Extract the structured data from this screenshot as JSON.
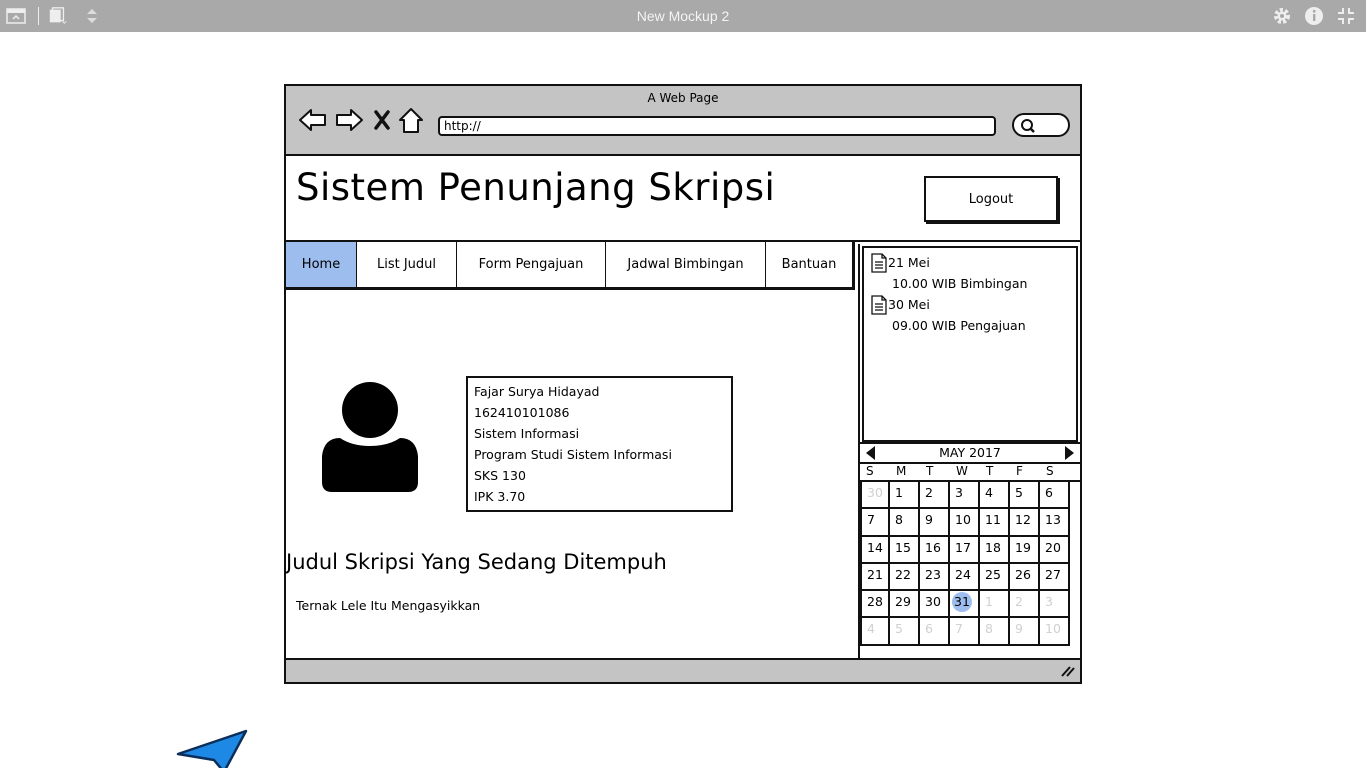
{
  "app": {
    "title": "New Mockup 2"
  },
  "browser": {
    "page_title": "A Web Page",
    "url": "http://"
  },
  "site": {
    "title": "Sistem Penunjang Skripsi",
    "logout_label": "Logout"
  },
  "tabs": [
    {
      "label": "Home",
      "active": true
    },
    {
      "label": "List Judul",
      "active": false
    },
    {
      "label": "Form Pengajuan",
      "active": false
    },
    {
      "label": "Jadwal Bimbingan",
      "active": false
    },
    {
      "label": "Bantuan",
      "active": false
    }
  ],
  "profile": {
    "name": "Fajar Surya Hidayad",
    "nim": "162410101086",
    "faculty": "Sistem Informasi",
    "program": "Program Studi Sistem Informasi",
    "sks": "SKS 130",
    "ipk": "IPK 3.70"
  },
  "thesis": {
    "heading": "Judul Skripsi Yang Sedang Ditempuh",
    "title": "Ternak Lele Itu Mengasyikkan"
  },
  "events": [
    {
      "date": "21 Mei",
      "detail": "10.00 WIB Bimbingan"
    },
    {
      "date": "30 Mei",
      "detail": "09.00 WIB Pengajuan"
    }
  ],
  "calendar": {
    "month_label": "MAY 2017",
    "weekdays": [
      "S",
      "M",
      "T",
      "W",
      "T",
      "F",
      "S"
    ],
    "weeks": [
      [
        "30",
        "1",
        "2",
        "3",
        "4",
        "5",
        "6"
      ],
      [
        "7",
        "8",
        "9",
        "10",
        "11",
        "12",
        "13"
      ],
      [
        "14",
        "15",
        "16",
        "17",
        "18",
        "19",
        "20"
      ],
      [
        "21",
        "22",
        "23",
        "24",
        "25",
        "26",
        "27"
      ],
      [
        "28",
        "29",
        "30",
        "31",
        "1",
        "2",
        "3"
      ],
      [
        "4",
        "5",
        "6",
        "7",
        "8",
        "9",
        "10"
      ]
    ],
    "selected": "31",
    "accent": "#9dbdef"
  },
  "colors": {
    "titlebar": "#a9a9a9",
    "chrome": "#c4c4c4",
    "active_tab": "#9dbdef",
    "cursor": "#1e88e5"
  }
}
